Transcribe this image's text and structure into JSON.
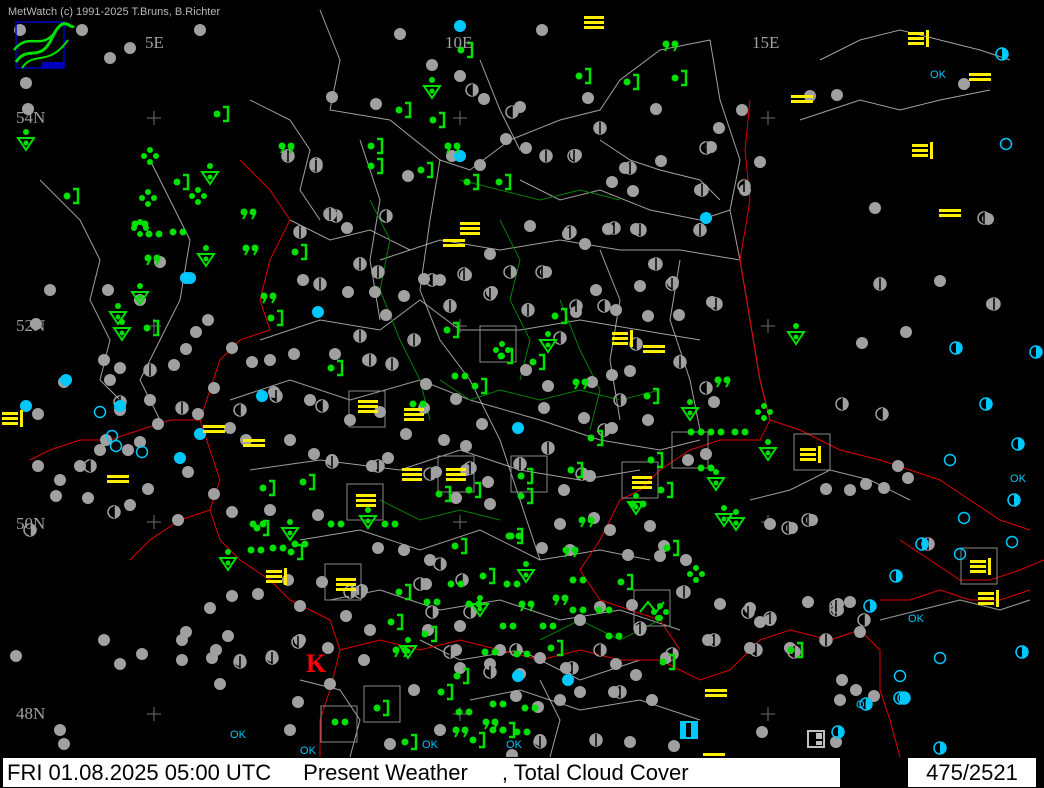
{
  "copyright": "MetWatch  (c) 1991-2025 T.Bruns, B.Richter",
  "longitudes": [
    "5E",
    "10E",
    "15E"
  ],
  "latitudes": [
    "54N",
    "52N",
    "50N",
    "48N"
  ],
  "status": {
    "datetime": "FRI 01.08.2025 05:00 UTC",
    "product": "Present Weather",
    "overlay": ", Total Cloud Cover",
    "count": "475/2521"
  },
  "colors": {
    "background": "#000000",
    "cloud_cover_overcast": "#a0a0a0",
    "cloud_cover_clear_partial": "#00c8ff",
    "rain_drizzle": "#00e000",
    "fog": "#ffee00",
    "borders": "#e00000",
    "admin_lines": "#c8c8c8",
    "rivers": "#008000",
    "marker_k": "#ff0000"
  },
  "legend_icons": {
    "overcast": "filled-gray-circle",
    "partly_cloudy": "half-cyan-circle",
    "clear": "open-cyan-circle",
    "rain": "green-dots",
    "drizzle": "green-comma",
    "shower": "green-triangle",
    "thunder_recent": "green-bracket",
    "fog": "yellow-bars",
    "mist": "yellow-double-bars"
  },
  "special_labels": {
    "ok": "OK",
    "thunderstorm": "K"
  }
}
